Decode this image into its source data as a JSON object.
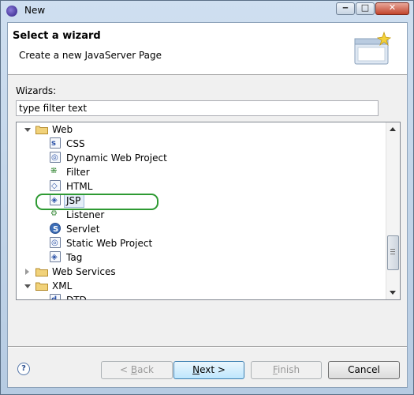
{
  "window": {
    "title": "New",
    "buttons": {
      "minimize": "‒",
      "maximize": "□",
      "close": "✕"
    }
  },
  "banner": {
    "title": "Select a wizard",
    "description": "Create a new JavaServer Page"
  },
  "wizards_label": "Wizards:",
  "filter": {
    "value": "type filter text"
  },
  "tree": {
    "items": [
      {
        "label": "Web",
        "kind": "folder",
        "state": "expanded"
      },
      {
        "label": "CSS",
        "kind": "file"
      },
      {
        "label": "Dynamic Web Project",
        "kind": "file"
      },
      {
        "label": "Filter",
        "kind": "file"
      },
      {
        "label": "HTML",
        "kind": "file"
      },
      {
        "label": "JSP",
        "kind": "file",
        "selected": true
      },
      {
        "label": "Listener",
        "kind": "file"
      },
      {
        "label": "Servlet",
        "kind": "file"
      },
      {
        "label": "Static Web Project",
        "kind": "file"
      },
      {
        "label": "Tag",
        "kind": "file"
      },
      {
        "label": "Web Services",
        "kind": "folder",
        "state": "collapsed"
      },
      {
        "label": "XML",
        "kind": "folder",
        "state": "expanded"
      },
      {
        "label": "DTD",
        "kind": "file",
        "partial": true
      }
    ]
  },
  "buttons": {
    "help": "?",
    "back": {
      "prefix": "< ",
      "mnemonic": "B",
      "rest": "ack"
    },
    "next": {
      "mnemonic": "N",
      "rest": "ext >"
    },
    "finish": {
      "mnemonic": "F",
      "rest": "inish"
    },
    "cancel": "Cancel"
  },
  "colors": {
    "highlight_ring": "#2e9a33",
    "selection": "#e4edf8"
  }
}
